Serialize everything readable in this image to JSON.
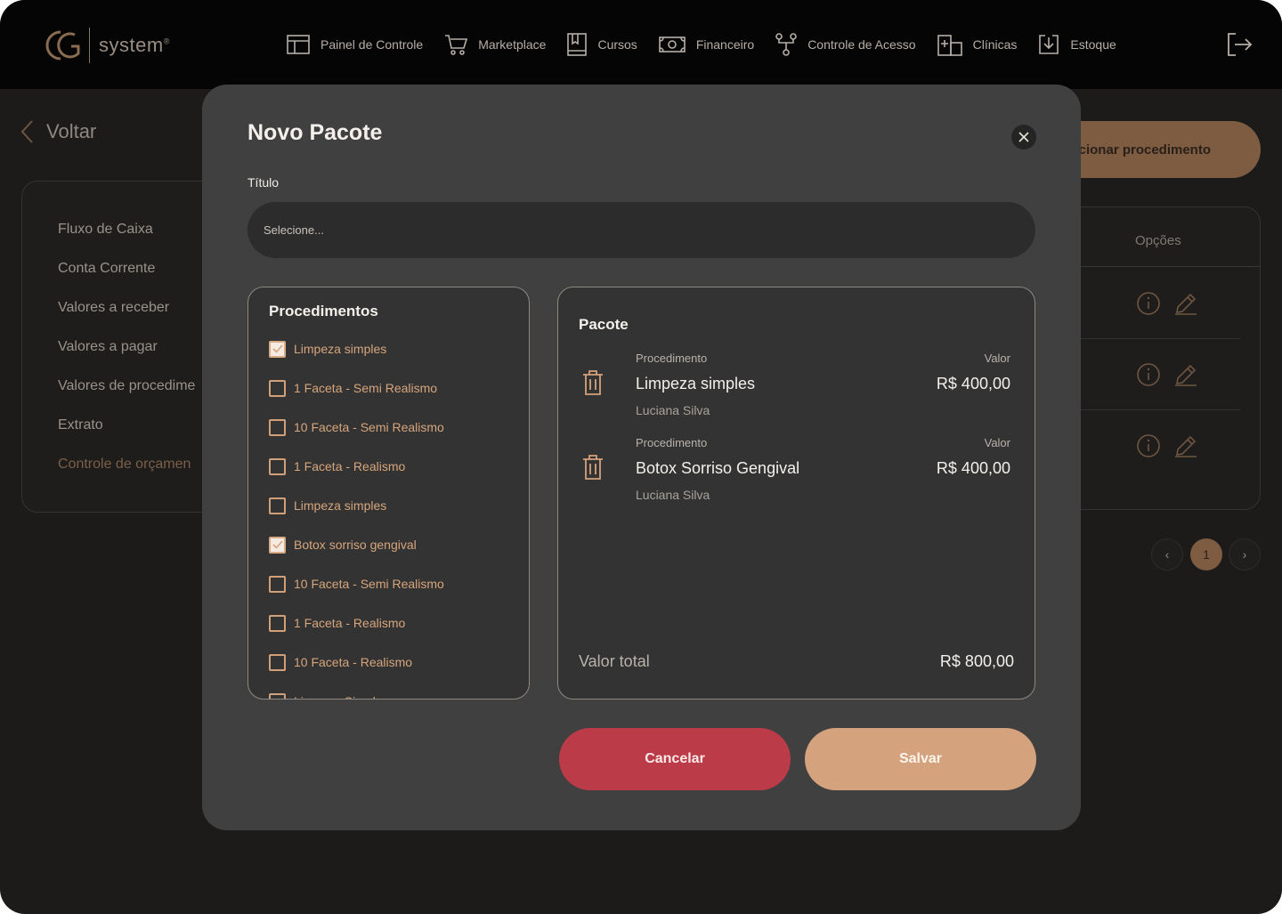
{
  "header": {
    "logo_text": "system",
    "nav": [
      {
        "label": "Painel de Controle",
        "icon": "dashboard-icon"
      },
      {
        "label": "Marketplace",
        "icon": "cart-icon"
      },
      {
        "label": "Cursos",
        "icon": "book-icon"
      },
      {
        "label": "Financeiro",
        "icon": "money-icon"
      },
      {
        "label": "Controle de Acesso",
        "icon": "network-icon"
      },
      {
        "label": "Clínicas",
        "icon": "building-icon"
      },
      {
        "label": "Estoque",
        "icon": "download-box-icon"
      }
    ]
  },
  "page": {
    "back_label": "Voltar",
    "sidebar": [
      "Fluxo de Caixa",
      "Conta Corrente",
      "Valores a receber",
      "Valores a pagar",
      "Valores de procedime",
      "Extrato",
      "Controle de orçamen"
    ],
    "add_button": "icionar procedimento",
    "table_header": "Opções",
    "pagination": {
      "current": "1",
      "prev": "‹",
      "next": "›"
    }
  },
  "modal": {
    "title": "Novo Pacote",
    "title_field_label": "Título",
    "title_field_placeholder": "Selecione...",
    "procedures_title": "Procedimentos",
    "procedures": [
      {
        "label": "Limpeza simples",
        "checked": true
      },
      {
        "label": "1 Faceta - Semi Realismo",
        "checked": false
      },
      {
        "label": "10 Faceta - Semi Realismo",
        "checked": false
      },
      {
        "label": "1 Faceta - Realismo",
        "checked": false
      },
      {
        "label": "Limpeza simples",
        "checked": false
      },
      {
        "label": "Botox sorriso gengival",
        "checked": true
      },
      {
        "label": "10 Faceta - Semi Realismo",
        "checked": false
      },
      {
        "label": "1 Faceta - Realismo",
        "checked": false
      },
      {
        "label": "10 Faceta - Realismo",
        "checked": false
      },
      {
        "label": "Limpeza Simples",
        "checked": false
      }
    ],
    "package_title": "Pacote",
    "package_items": [
      {
        "proc_label": "Procedimento",
        "value_label": "Valor",
        "name": "Limpeza simples",
        "value": "R$ 400,00",
        "person": "Luciana Silva"
      },
      {
        "proc_label": "Procedimento",
        "value_label": "Valor",
        "name": "Botox Sorriso Gengival",
        "value": "R$ 400,00",
        "person": "Luciana Silva"
      }
    ],
    "total_label": "Valor total",
    "total_value": "R$ 800,00",
    "cancel_label": "Cancelar",
    "save_label": "Salvar"
  },
  "colors": {
    "accent": "#d4a27c",
    "danger": "#bc3b48",
    "modal_bg": "#404040",
    "page_bg": "#1c1b1a"
  }
}
